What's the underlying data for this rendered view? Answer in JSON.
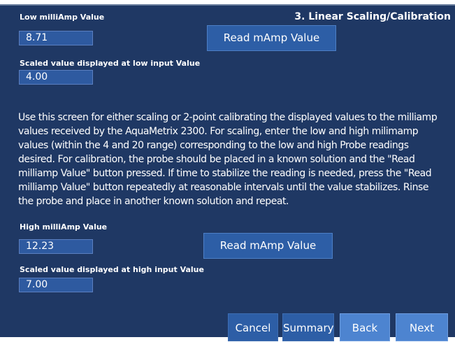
{
  "screen": {
    "title": "3. Linear Scaling/Calibration",
    "description": "Use this screen for either scaling or 2-point calibrating the displayed values to the milliamp values received by the AquaMetrix 2300. For scaling, enter the low and high milimamp values (within the 4 and 20 range) corresponding to the low and high Probe readings desired. For calibration, the probe should be placed in a known solution and the \"Read milliamp Value\" button pressed. If time to stabilize the reading is needed, press the \"Read milliamp Value\" button repeatedly at reasonable intervals until the value stabilizes. Rinse the probe and place in another known solution and repeat."
  },
  "low": {
    "milliamp_label": "Low milliAmp Value",
    "milliamp_value": "8.71",
    "read_button": "Read mAmp Value",
    "scaled_label": "Scaled value displayed at low input Value",
    "scaled_value": "4.00"
  },
  "high": {
    "milliamp_label": "High milliAmp Value",
    "milliamp_value": "12.23",
    "read_button": "Read mAmp Value",
    "scaled_label": "Scaled value displayed at high input Value",
    "scaled_value": "7.00"
  },
  "footer": {
    "cancel": "Cancel",
    "summary": "Summary",
    "back": "Back",
    "next": "Next"
  },
  "colors": {
    "panel_background": "#1f3864",
    "field_background": "#2e5aa0",
    "button_background": "#2d5ea6",
    "nav_button_background": "#4d84d0"
  }
}
